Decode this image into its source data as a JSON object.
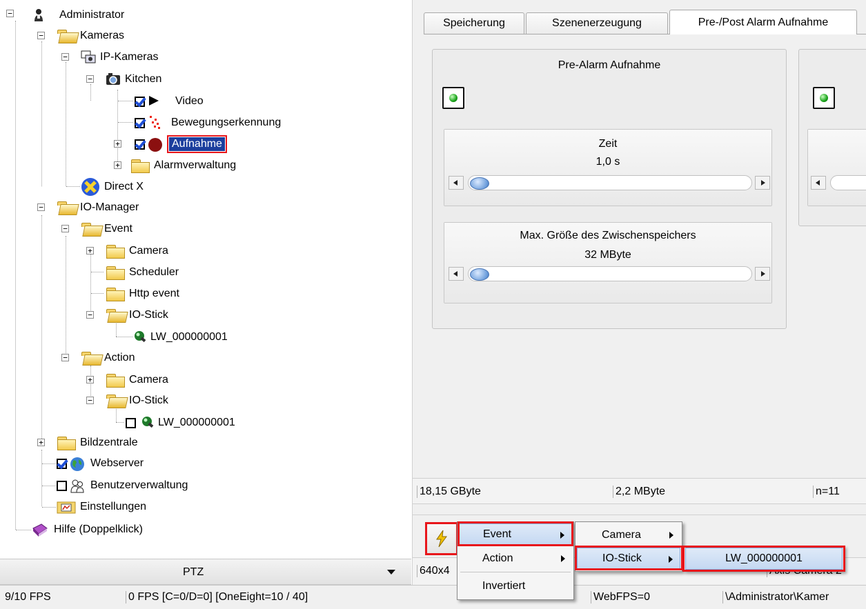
{
  "tree": {
    "administrator": "Administrator",
    "kameras": "Kameras",
    "ip_kameras": "IP-Kameras",
    "kitchen": "Kitchen",
    "video": "Video",
    "bewegungserkennung": "Bewegungserkennung",
    "aufnahme": "Aufnahme",
    "alarmverwaltung": "Alarmverwaltung",
    "direct_x": "Direct X",
    "io_manager": "IO-Manager",
    "event": "Event",
    "event_camera": "Camera",
    "scheduler": "Scheduler",
    "http_event": "Http event",
    "event_io_stick": "IO-Stick",
    "event_lw": "LW_000000001",
    "action": "Action",
    "action_camera": "Camera",
    "action_io_stick": "IO-Stick",
    "action_lw": "LW_000000001",
    "bildzentrale": "Bildzentrale",
    "webserver": "Webserver",
    "benutzerverwaltung": "Benutzerverwaltung",
    "einstellungen": "Einstellungen",
    "hilfe": "Hilfe (Doppelklick)"
  },
  "ptz": {
    "label": "PTZ"
  },
  "tabs": [
    "Speicherung",
    "Szenenerzeugung",
    "Pre-/Post Alarm Aufnahme"
  ],
  "pre_alarm": {
    "title": "Pre-Alarm Aufnahme",
    "zeit_label": "Zeit",
    "zeit_value": "1,0 s",
    "buffer_label": "Max. Größe des Zwischenspeichers",
    "buffer_value": "32 MByte",
    "zeit_position": 0.0,
    "buffer_position": 0.0
  },
  "status_strip": {
    "a": "18,15 GByte",
    "b": "2,2 MByte",
    "c": "n=11"
  },
  "info_row": {
    "a": "640x4",
    "b": "",
    "c": "",
    "d": "",
    "e": "Axis Camera 2"
  },
  "statusbar": {
    "fps": "9/10 FPS",
    "fps_detail": "0 FPS [C=0/D=0] [OneEight=10 / 40]",
    "web_fps": "WebFPS=0",
    "path": "\\Administrator\\Kamer"
  },
  "menu1": {
    "event": "Event",
    "action": "Action",
    "invertiert": "Invertiert"
  },
  "menu2": {
    "camera": "Camera",
    "io_stick": "IO-Stick"
  },
  "menu3": {
    "lw": "LW_000000001"
  },
  "colors": {
    "selection": "#1c3f9e",
    "highlight_frame": "#e8161b",
    "menu_highlight": "#c4d8f2"
  }
}
